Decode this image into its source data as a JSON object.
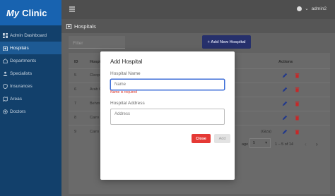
{
  "brand": {
    "my": "My",
    "clinic": "Clinic"
  },
  "sidebar": {
    "items": [
      {
        "label": "Admin Dashboard",
        "icon": "dashboard-icon",
        "active": false
      },
      {
        "label": "Hospitals",
        "icon": "hospital-icon",
        "active": true
      },
      {
        "label": "Departments",
        "icon": "departments-icon",
        "active": false
      },
      {
        "label": "Specialists",
        "icon": "specialists-icon",
        "active": false
      },
      {
        "label": "Insurances",
        "icon": "insurance-icon",
        "active": false
      },
      {
        "label": "Areas",
        "icon": "areas-icon",
        "active": false
      },
      {
        "label": "Doctors",
        "icon": "doctors-icon",
        "active": false
      }
    ]
  },
  "topbar": {
    "username": "admin2",
    "caret": "⌄"
  },
  "page": {
    "title": "Hospitals"
  },
  "toolbar": {
    "filter_placeholder": "Filter",
    "add_label": "+  Add New Hospital"
  },
  "table": {
    "headers": {
      "id": "ID",
      "name": "Hospit",
      "actions": "Actions"
    },
    "rows": [
      {
        "id": "5",
        "name": "Cleop"
      },
      {
        "id": "6",
        "name": "Arab C"
      },
      {
        "id": "7",
        "name": "Behm"
      },
      {
        "id": "8",
        "name": "Cairo"
      },
      {
        "id": "9",
        "name": "Cairo",
        "address_tail": "(Giza)"
      }
    ],
    "pager": {
      "per_page_label": "age",
      "per_page_value": "5",
      "range": "1 – 5 of 14"
    }
  },
  "modal": {
    "title": "Add Hospital",
    "name_label": "Hospital Name",
    "name_placeholder": "Name",
    "name_error": "Name is required",
    "address_label": "Hospital Address",
    "address_placeholder": "Address",
    "close_label": "Close",
    "add_label": "Add"
  },
  "colors": {
    "sidebar": "#12406b",
    "brand": "#1863b0",
    "accent": "#26306b",
    "danger": "#e53935"
  }
}
